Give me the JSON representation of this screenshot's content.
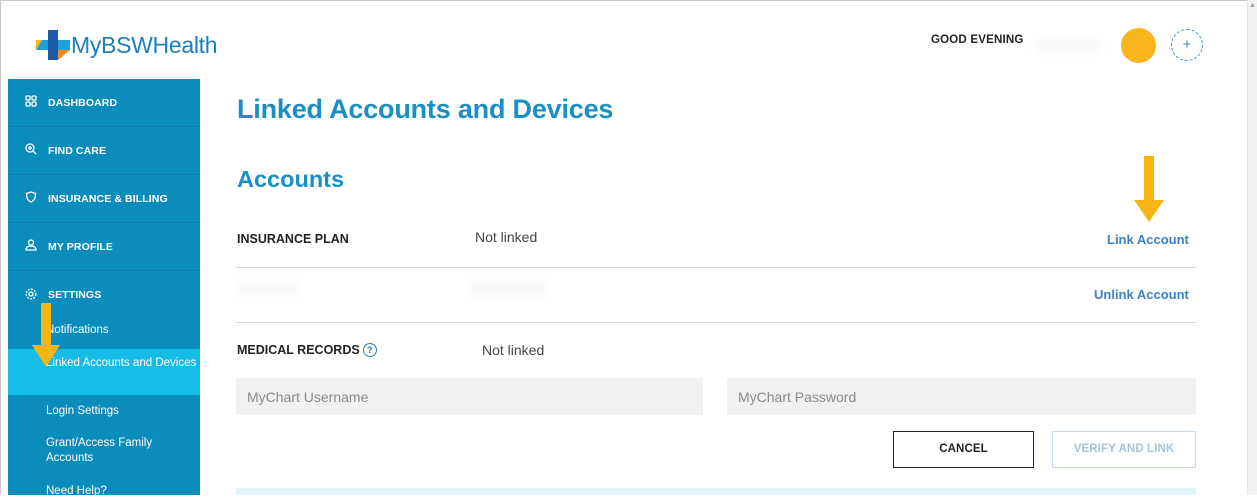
{
  "app": {
    "logo_text": "MyBSWHealth",
    "greeting": "GOOD EVENING",
    "add_symbol": "+"
  },
  "sidebar": {
    "items": [
      {
        "label": "DASHBOARD",
        "icon": "grid-icon"
      },
      {
        "label": "FIND CARE",
        "icon": "search-plus-icon"
      },
      {
        "label": "INSURANCE & BILLING",
        "icon": "shield-icon"
      },
      {
        "label": "MY PROFILE",
        "icon": "user-icon"
      },
      {
        "label": "SETTINGS",
        "icon": "gear-icon"
      }
    ],
    "settings_sub": [
      {
        "label": "Notifications"
      },
      {
        "label": "Linked Accounts and Devices",
        "active": true
      },
      {
        "label": "Login Settings"
      },
      {
        "label": "Grant/Access Family Accounts"
      },
      {
        "label": "Need Help?"
      }
    ]
  },
  "main": {
    "page_title": "Linked Accounts and Devices",
    "section_title": "Accounts",
    "insurance": {
      "label": "INSURANCE PLAN",
      "status": "Not linked",
      "action": "Link Account"
    },
    "redacted_row": {
      "action": "Unlink Account"
    },
    "medical": {
      "label": "MEDICAL RECORDS",
      "help": "?",
      "status": "Not linked",
      "username_placeholder": "MyChart Username",
      "password_placeholder": "MyChart Password",
      "cancel_label": "CANCEL",
      "verify_label": "VERIFY AND LINK"
    }
  },
  "colors": {
    "brand_blue": "#1a8fc4",
    "sidebar": "#0b8dbb",
    "sidebar_active": "#15bde6",
    "avatar": "#f9b51c",
    "annotation": "#f7b514"
  }
}
